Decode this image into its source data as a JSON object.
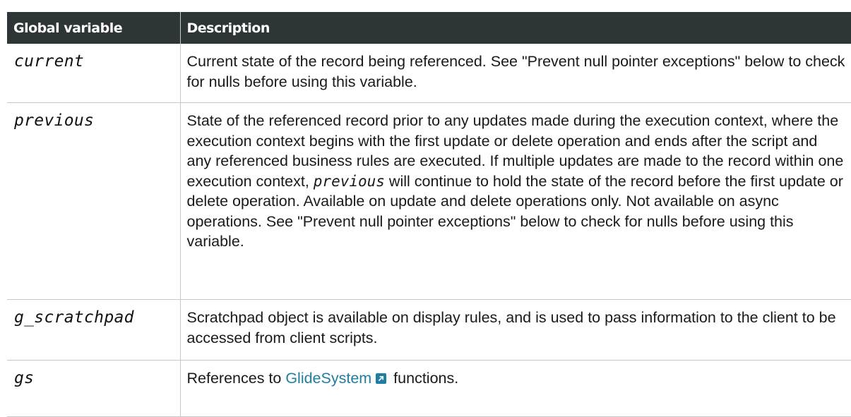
{
  "table": {
    "headers": {
      "variable": "Global variable",
      "description": "Description"
    },
    "rows": [
      {
        "name": "current",
        "description": "Current state of the record being referenced. See \"Prevent null pointer exceptions\" below to check for nulls before using this variable."
      },
      {
        "name": "previous",
        "description_before": "State of the referenced record prior to any updates made during the execution context, where the execution context begins with the first update or delete operation and ends after the script and any referenced business rules are executed. If multiple updates are made to the record within one execution context, ",
        "description_code": "previous",
        "description_after": " will continue to hold the state of the record before the first update or delete operation. Available on update and delete operations only. Not available on async operations. See \"Prevent null pointer exceptions\" below to check for nulls before using this variable."
      },
      {
        "name": "g_scratchpad",
        "description": "Scratchpad object is available on display rules, and is used to pass information to the client to be accessed from client scripts."
      },
      {
        "name": "gs",
        "description_before": "References to ",
        "link_text": "GlideSystem",
        "link_icon": "external-link-icon",
        "description_after": " functions."
      }
    ]
  },
  "colors": {
    "header_bg": "#2e3536",
    "header_text": "#ffffff",
    "link": "#1f7ea1",
    "border": "#c8c8c8"
  }
}
